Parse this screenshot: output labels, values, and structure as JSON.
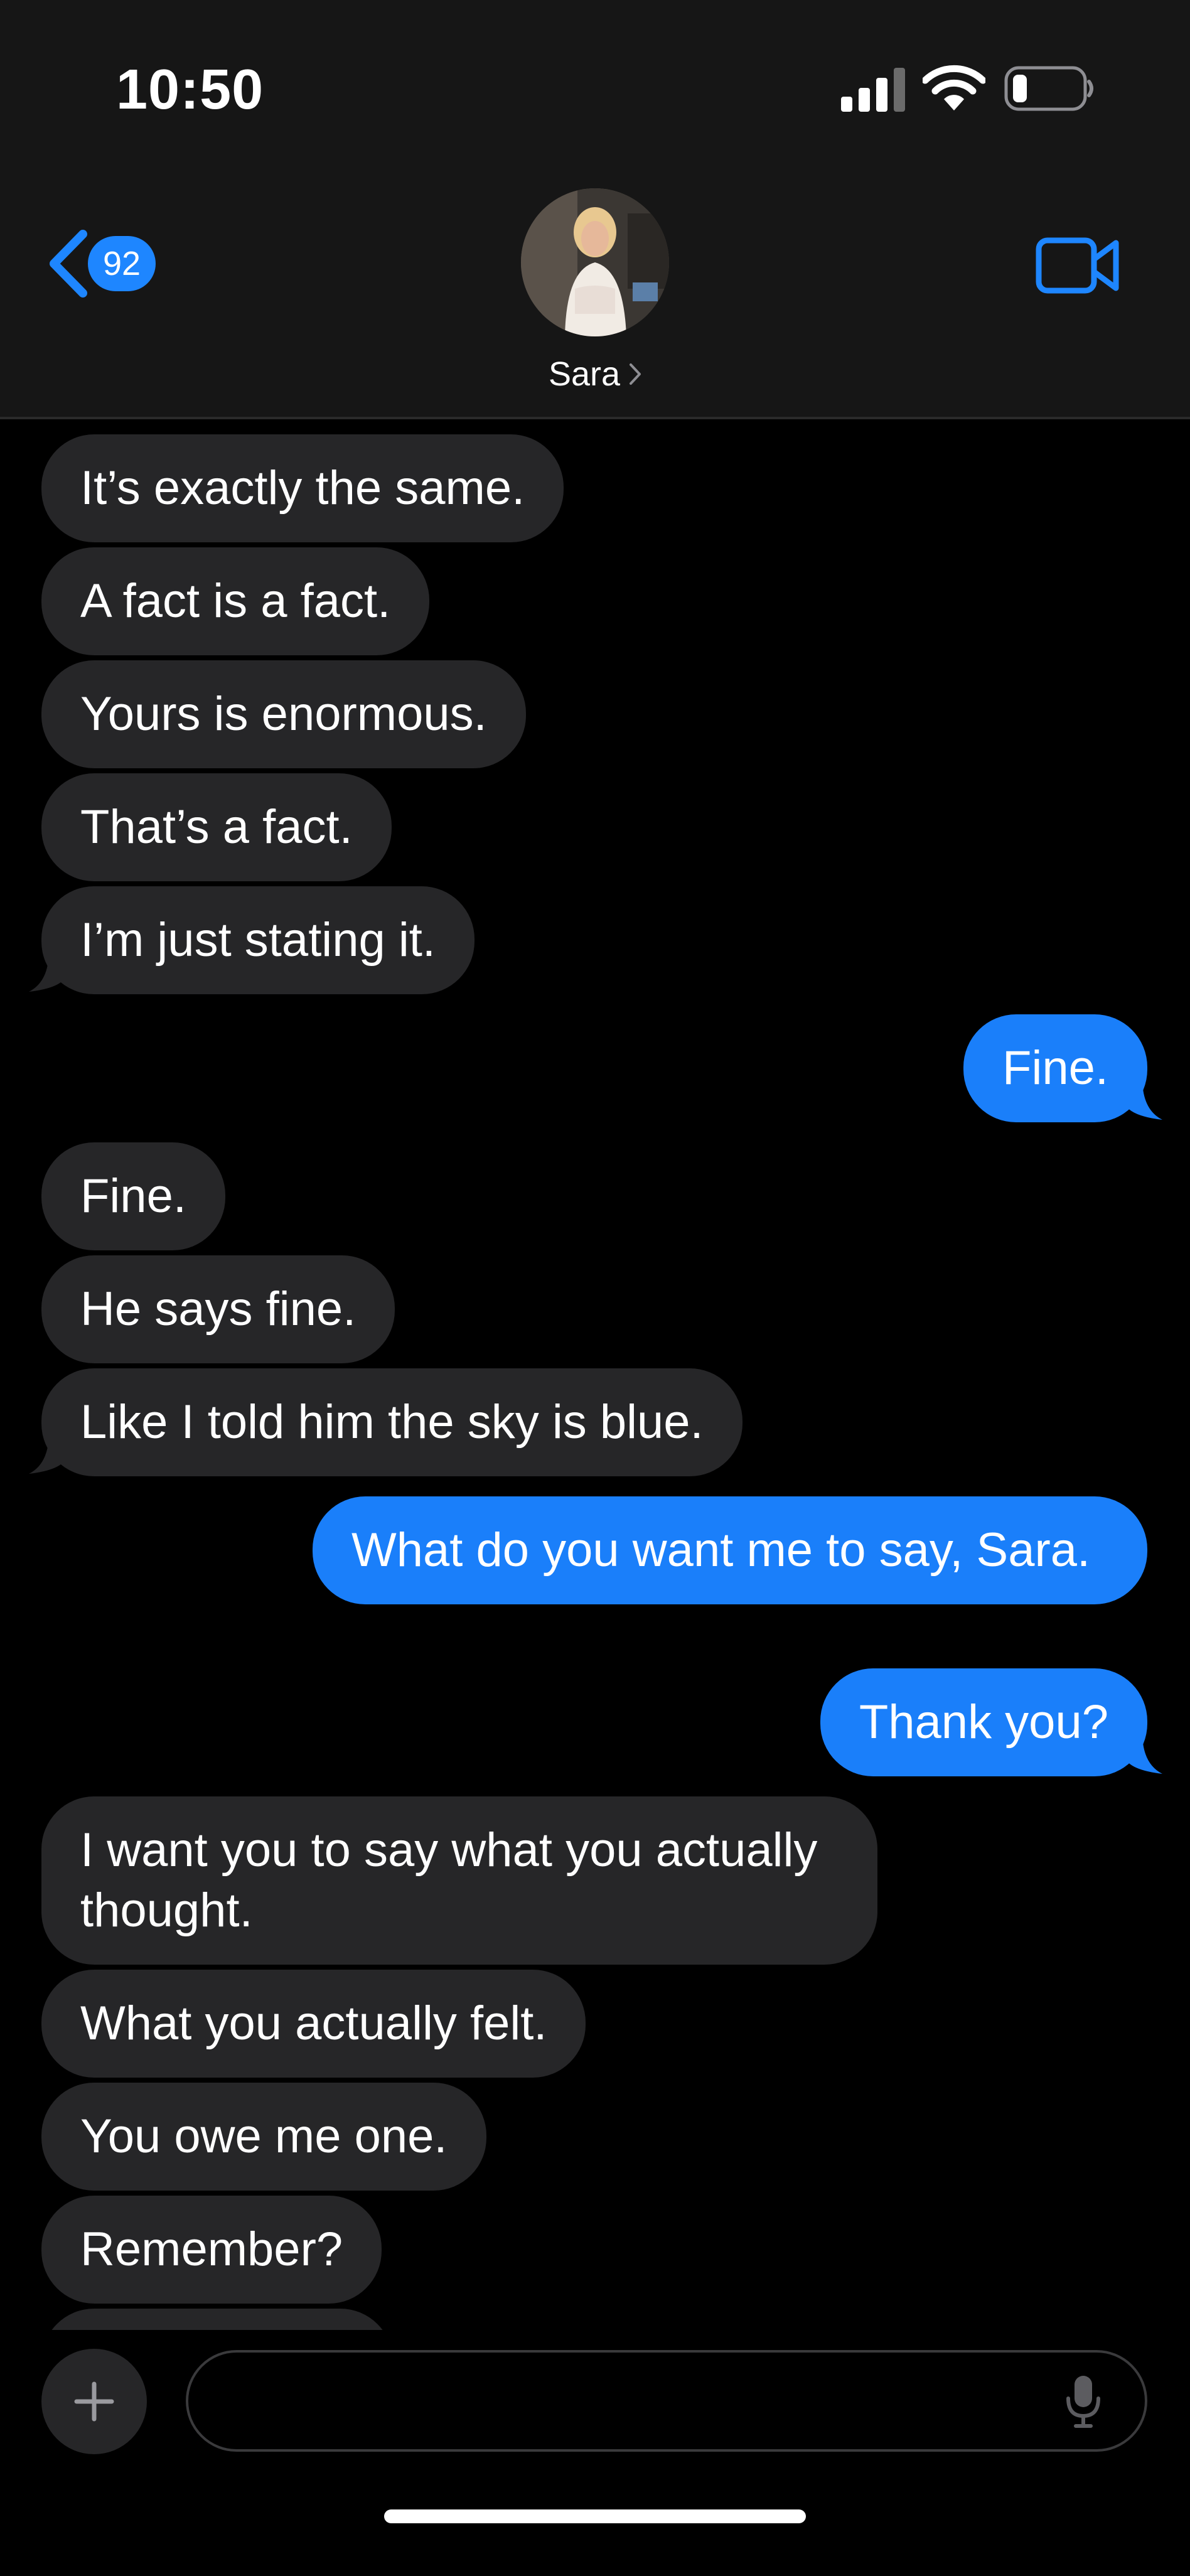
{
  "status_bar": {
    "time": "10:50"
  },
  "header": {
    "back_badge_count": "92",
    "contact_name": "Sara",
    "accent_color": "#1e86ff"
  },
  "messages": [
    {
      "side": "in",
      "text": "It’s exactly the same."
    },
    {
      "side": "in",
      "text": "A fact is a fact."
    },
    {
      "side": "in",
      "text": "Yours is enormous."
    },
    {
      "side": "in",
      "text": "That’s a fact."
    },
    {
      "side": "in",
      "text": "I’m just stating it."
    },
    {
      "side": "out",
      "text": "Fine."
    },
    {
      "side": "in",
      "text": "Fine."
    },
    {
      "side": "in",
      "text": "He says fine."
    },
    {
      "side": "in",
      "text": "Like I told him the sky is blue."
    },
    {
      "side": "out",
      "text": "What do you want me to say, Sara."
    },
    {
      "side": "out",
      "text": "Thank you?"
    },
    {
      "side": "in",
      "text": "I want you to say what you actually thought."
    },
    {
      "side": "in",
      "text": "What you actually felt."
    },
    {
      "side": "in",
      "text": "You owe me one."
    },
    {
      "side": "in",
      "text": "Remember?"
    }
  ],
  "composer": {
    "input_value": "",
    "placeholder": ""
  },
  "icons": {
    "back": "chevron-left-icon",
    "video": "video-camera-icon",
    "add": "plus-icon",
    "mic": "microphone-icon"
  }
}
